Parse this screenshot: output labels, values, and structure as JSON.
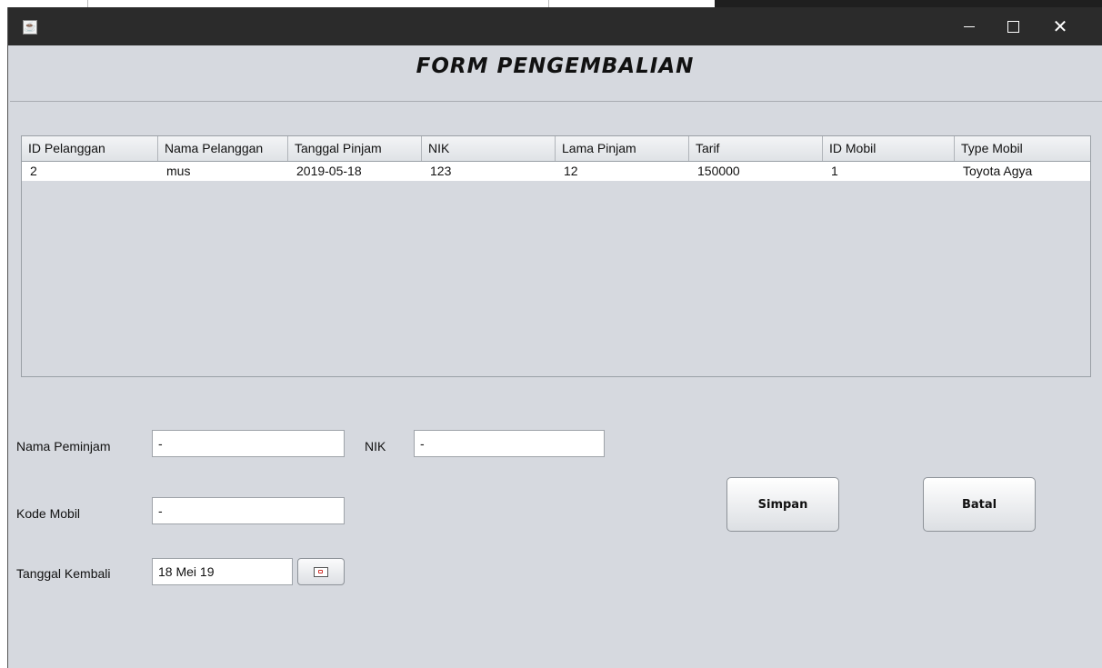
{
  "form": {
    "title": "FORM PENGEMBALIAN"
  },
  "table": {
    "columns": [
      "ID Pelanggan",
      "Nama Pelanggan",
      "Tanggal Pinjam",
      "NIK",
      "Lama Pinjam",
      "Tarif",
      "ID Mobil",
      "Type Mobil"
    ],
    "rows": [
      [
        "2",
        "mus",
        "2019-05-18",
        "123",
        "12",
        "150000",
        "1",
        "Toyota Agya"
      ]
    ]
  },
  "fields": {
    "nama_peminjam": {
      "label": "Nama Peminjam",
      "value": "-"
    },
    "nik": {
      "label": "NIK",
      "value": "-"
    },
    "kode_mobil": {
      "label": "Kode Mobil",
      "value": "-"
    },
    "tanggal_kembali": {
      "label": "Tanggal Kembali",
      "value": "18 Mei 19"
    }
  },
  "buttons": {
    "simpan": "Simpan",
    "batal": "Batal"
  },
  "icons": {
    "app": "java-icon",
    "date_picker": "calendar-icon",
    "minimize": "minimize-icon",
    "maximize": "maximize-icon",
    "close": "close-icon"
  }
}
